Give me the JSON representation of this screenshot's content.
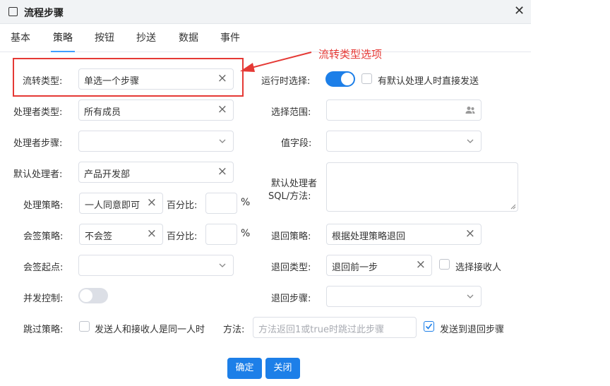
{
  "window": {
    "title": "流程步骤"
  },
  "tabs": [
    "基本",
    "策略",
    "按钮",
    "抄送",
    "数据",
    "事件"
  ],
  "active_tab": "策略",
  "annotation": {
    "text": "流转类型选项",
    "color": "#e53935"
  },
  "form": {
    "flow_type": {
      "label": "流转类型:",
      "value": "单选一个步骤"
    },
    "runtime_select": {
      "label": "运行时选择:",
      "enabled": true
    },
    "direct_send": {
      "label": "有默认处理人时直接发送",
      "checked": false
    },
    "handler_type": {
      "label": "处理者类型:",
      "value": "所有成员"
    },
    "select_range": {
      "label": "选择范围:",
      "value": ""
    },
    "handler_step": {
      "label": "处理者步骤:",
      "value": ""
    },
    "value_field": {
      "label": "值字段:",
      "value": ""
    },
    "default_handler": {
      "label": "默认处理者:",
      "value": "产品开发部"
    },
    "default_handler_sql": {
      "label_line1": "默认处理者",
      "label_line2": "SQL/方法:",
      "value": ""
    },
    "handle_strategy": {
      "label": "处理策略:",
      "value": "一人同意即可"
    },
    "percent1": {
      "label": "百分比:",
      "value": "",
      "unit": "%"
    },
    "countersign_strategy": {
      "label": "会签策略:",
      "value": "不会签"
    },
    "percent2": {
      "label": "百分比:",
      "value": "",
      "unit": "%"
    },
    "return_strategy": {
      "label": "退回策略:",
      "value": "根据处理策略退回"
    },
    "countersign_start": {
      "label": "会签起点:",
      "value": ""
    },
    "return_type": {
      "label": "退回类型:",
      "value": "退回前一步"
    },
    "select_receiver": {
      "label": "选择接收人",
      "checked": false
    },
    "concurrency": {
      "label": "并发控制:",
      "enabled": false
    },
    "return_step": {
      "label": "退回步骤:",
      "value": ""
    },
    "skip_strategy": {
      "label": "跳过策略:"
    },
    "same_person": {
      "label": "发送人和接收人是同一人时",
      "checked": false
    },
    "method": {
      "label": "方法:",
      "placeholder": "方法返回1或true时跳过此步骤"
    },
    "send_to_return_step": {
      "label": "发送到退回步骤",
      "checked": true
    }
  },
  "buttons": {
    "ok": "确定",
    "close": "关闭"
  },
  "colors": {
    "primary": "#1d7fe8",
    "border": "#dcdfe6"
  }
}
